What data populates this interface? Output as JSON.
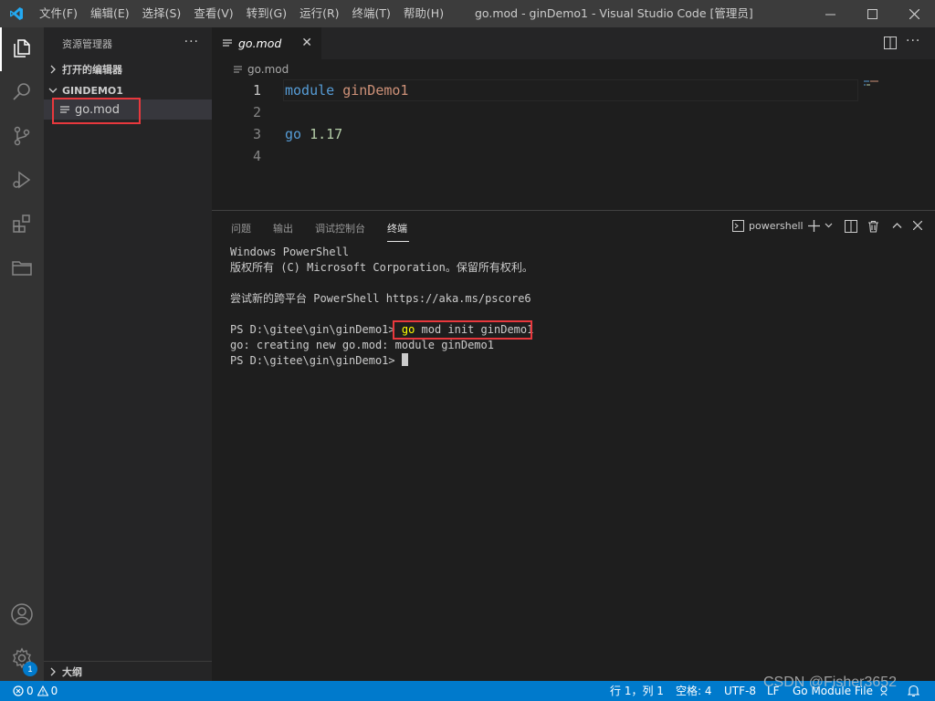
{
  "titlebar": {
    "menu": [
      "文件(F)",
      "编辑(E)",
      "选择(S)",
      "查看(V)",
      "转到(G)",
      "运行(R)",
      "终端(T)",
      "帮助(H)"
    ],
    "title": "go.mod - ginDemo1 - Visual Studio Code [管理员]"
  },
  "activitybar": {
    "items": [
      "files-icon",
      "search-icon",
      "source-control-icon",
      "run-debug-icon",
      "extensions-icon",
      "remote-explorer-icon"
    ],
    "bottom_items": [
      "account-icon",
      "settings-gear-icon"
    ],
    "settings_badge": "1"
  },
  "sidebar": {
    "header": "资源管理器",
    "more": "···",
    "open_editors": "打开的编辑器",
    "folder": "GINDEMO1",
    "files": [
      {
        "name": "go.mod"
      }
    ],
    "outline": "大纲"
  },
  "editor": {
    "tab_label": "go.mod",
    "breadcrumb": "go.mod",
    "lines": [
      {
        "num": "1",
        "kw": "module",
        "val": "ginDemo1"
      },
      {
        "num": "2",
        "kw": "",
        "val": ""
      },
      {
        "num": "3",
        "kw": "go",
        "val": "1.17"
      },
      {
        "num": "4",
        "kw": "",
        "val": ""
      }
    ]
  },
  "panel": {
    "tabs": [
      "问题",
      "输出",
      "调试控制台",
      "终端"
    ],
    "active_tab": "终端",
    "terminal_name": "powershell",
    "terminal_lines": [
      "Windows PowerShell",
      "版权所有 (C) Microsoft Corporation。保留所有权利。",
      "",
      "尝试新的跨平台 PowerShell https://aka.ms/pscore6",
      ""
    ],
    "prompt": "PS D:\\gitee\\gin\\ginDemo1>",
    "command_kw": "go",
    "command_rest": " mod init ginDemo1",
    "output_line": "go: creating new go.mod: module ginDemo1",
    "prompt2": "PS D:\\gitee\\gin\\ginDemo1>"
  },
  "statusbar": {
    "errors": "0",
    "warnings": "0",
    "position": "行 1，列 1",
    "spaces": "空格: 4",
    "encoding": "UTF-8",
    "eol": "LF",
    "language": "Go Module File",
    "bg_color": "#007acc"
  },
  "watermark": "CSDN @Fisher3652",
  "colors": {
    "highlight_box": "#e8383d",
    "keyword": "#569cd6",
    "string": "#ce9178",
    "number": "#b5cea8"
  }
}
